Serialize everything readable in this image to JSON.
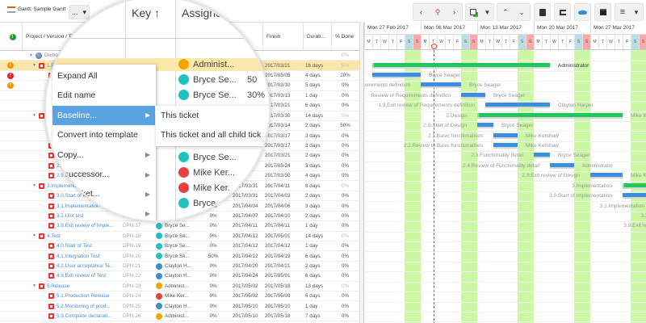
{
  "title": "Gantt: Sample Gantt",
  "title_menu": "...",
  "toolbar": {
    "prev": "‹",
    "today": "⚲",
    "next": "›",
    "caret": "▾",
    "up": "⌃",
    "down": "⌄",
    "menu": "≡"
  },
  "columns": {
    "project": "Project / Version / Ticket",
    "key": "Key",
    "sort": "↑",
    "assignee": "Assignee",
    "start_frag": "rt",
    "finish": "Finish",
    "duration": "Durati...",
    "done": "% Done"
  },
  "rows": [
    {
      "level": 0,
      "name": "Demo Project",
      "key": "",
      "assignee": "",
      "progress": "",
      "start": "",
      "finish": "",
      "duration": "",
      "done": "0%",
      "parent": true
    },
    {
      "level": 1,
      "name": "1.Requirements",
      "key": "DPN-1",
      "assignee": "Administ...",
      "av": "#f0a500",
      "progress": "",
      "start": "",
      "finish": "2017/03/21",
      "duration": "16 days",
      "done": "5%",
      "warn": "#f39200",
      "parent": true,
      "hl": true
    },
    {
      "level": 2,
      "name": "",
      "key": "",
      "assignee": "Bryce Se...",
      "av": "#1fc1c1",
      "progress": "50%",
      "start": "",
      "finish": "2017/03/05",
      "duration": "4 days",
      "done": "20%",
      "warn": "#e02020"
    },
    {
      "level": 2,
      "name": "",
      "key": "",
      "assignee": "Bryce Se...",
      "av": "#1fc1c1",
      "progress": "30%",
      "start": "",
      "finish": "2017/03/10",
      "duration": "5 days",
      "done": "0%",
      "warn": "#f39200"
    },
    {
      "level": 2,
      "name": "",
      "key": "",
      "assignee": "",
      "progress": "",
      "start": "",
      "finish": "2017/03/13",
      "duration": "1 day",
      "done": "0%"
    },
    {
      "level": 2,
      "name": "",
      "key": "",
      "assignee": "",
      "progress": "",
      "start": "",
      "finish": "2017/03/21",
      "duration": "6 days",
      "done": "0%"
    },
    {
      "level": 1,
      "name": "",
      "key": "",
      "assignee": "",
      "progress": "",
      "start": "",
      "finish": "2017/03/30",
      "duration": "14 days",
      "done": "5%",
      "parent": true
    },
    {
      "level": 2,
      "name": "",
      "key": "",
      "assignee": "",
      "progress": "",
      "start": "",
      "finish": "2017/03/14",
      "duration": "2 days",
      "done": "50%"
    },
    {
      "level": 2,
      "name": "",
      "key": "",
      "assignee": "",
      "progress": "",
      "start": "",
      "finish": "2017/03/17",
      "duration": "3 days",
      "done": "0%"
    },
    {
      "level": 2,
      "name": "",
      "key": "",
      "assignee": "",
      "progress": "",
      "start": "",
      "finish": "2017/03/17",
      "duration": "3 days",
      "done": "0%"
    },
    {
      "level": 2,
      "name": "",
      "key": "",
      "assignee": "Bryce Se...",
      "av": "#1fc1c1",
      "progress": "",
      "start": "",
      "finish": "2017/03/21",
      "duration": "2 days",
      "done": "0%"
    },
    {
      "level": 2,
      "name": "2.A",
      "key": "",
      "assignee": "Mike Ker...",
      "av": "#e84040",
      "progress": "",
      "start": "",
      "finish": "2017/03/24",
      "duration": "3 days",
      "done": "0%"
    },
    {
      "level": 2,
      "name": "2.9.E",
      "key": "",
      "assignee": "Mike Ker...",
      "av": "#e84040",
      "progress": "",
      "start": "",
      "finish": "2017/03/30",
      "duration": "4 days",
      "done": "0%"
    },
    {
      "level": 1,
      "name": "3.Implementation",
      "key": "",
      "assignee": "Mike Ker...",
      "av": "#e84040",
      "progress": "",
      "start": "2017/03/31",
      "finish": "2017/04/11",
      "duration": "8 days",
      "done": "0%",
      "parent": true
    },
    {
      "level": 2,
      "name": "3.0.Start of Im",
      "key": "",
      "assignee": "Bryce",
      "av": "#1fc1c1",
      "progress": "",
      "start": "2017/03/31",
      "finish": "2017/04/03",
      "duration": "2 days",
      "done": "0%"
    },
    {
      "level": 2,
      "name": "3.1.Implementation",
      "key": "",
      "assignee": "",
      "progress": "0%",
      "start": "2017/04/04",
      "finish": "2017/04/06",
      "duration": "3 days",
      "done": "0%"
    },
    {
      "level": 2,
      "name": "3.2.Unit test",
      "key": "DPN-16",
      "assignee": "Administ...",
      "av": "#f0a500",
      "progress": "0%",
      "start": "2017/04/07",
      "finish": "2017/04/10",
      "duration": "2 days",
      "done": "0%"
    },
    {
      "level": 2,
      "name": "3.9.Exit review of Imple...",
      "key": "DPN-17",
      "assignee": "Bryce Se...",
      "av": "#1fc1c1",
      "progress": "0%",
      "start": "2017/04/11",
      "finish": "2017/04/11",
      "duration": "1 day",
      "done": "0%"
    },
    {
      "level": 1,
      "name": "4.Test",
      "key": "DPN-18",
      "assignee": "Bryce Se...",
      "av": "#1fc1c1",
      "progress": "0%",
      "start": "2017/04/12",
      "finish": "2017/05/01",
      "duration": "14 days",
      "done": "0%",
      "parent": true
    },
    {
      "level": 2,
      "name": "4.0.Start of Test",
      "key": "DPN-19",
      "assignee": "Bryce Se...",
      "av": "#1fc1c1",
      "progress": "0%",
      "start": "2017/04/12",
      "finish": "2017/04/12",
      "duration": "1 day",
      "done": "0%"
    },
    {
      "level": 2,
      "name": "4.1.Integration Test",
      "key": "DPN-20",
      "assignee": "Bryce Se...",
      "av": "#1fc1c1",
      "progress": "50%",
      "start": "2017/04/12",
      "finish": "2017/04/19",
      "duration": "6 days",
      "done": "0%"
    },
    {
      "level": 2,
      "name": "4.2.User acceptance Te...",
      "key": "DPN-21",
      "assignee": "Clayton H...",
      "av": "#3a8fd0",
      "progress": "0%",
      "start": "2017/04/20",
      "finish": "2017/04/21",
      "duration": "2 days",
      "done": "0%"
    },
    {
      "level": 2,
      "name": "4.9.Exit review of Test",
      "key": "DPN-22",
      "assignee": "Clayton H...",
      "av": "#3a8fd0",
      "progress": "0%",
      "start": "2017/04/24",
      "finish": "2017/05/01",
      "duration": "6 days",
      "done": "0%"
    },
    {
      "level": 1,
      "name": "5.Release",
      "key": "DPN-23",
      "assignee": "Administ...",
      "av": "#f0a500",
      "progress": "0%",
      "start": "2017/05/02",
      "finish": "2017/05/18",
      "duration": "13 days",
      "done": "0%",
      "parent": true
    },
    {
      "level": 2,
      "name": "5.1.Production Release",
      "key": "DPN-24",
      "assignee": "Mike Ker...",
      "av": "#e84040",
      "progress": "0%",
      "start": "2017/05/02",
      "finish": "2017/05/09",
      "duration": "6 days",
      "done": "0%"
    },
    {
      "level": 2,
      "name": "5.2.Monitoring of prod...",
      "key": "DPN-25",
      "assignee": "Clayton H...",
      "av": "#3a8fd0",
      "progress": "0%",
      "start": "2017/05/10",
      "finish": "2017/05/10",
      "duration": "1 day",
      "done": "0%"
    },
    {
      "level": 2,
      "name": "5.9.Complete declarati...",
      "key": "DPN-26",
      "assignee": "Administ...",
      "av": "#f0a500",
      "progress": "0%",
      "start": "2017/05/10",
      "finish": "2017/05/18",
      "duration": "7 days",
      "done": "0%"
    }
  ],
  "gantt": {
    "weeks": [
      "Mon 27 Feb 2017",
      "Mon 06 Mar 2017",
      "Mon 13 Mar 2017",
      "Mon 20 Mar 2017",
      "Mon 27 Mar 2017"
    ],
    "weekdays": [
      "M",
      "T",
      "W",
      "T",
      "F",
      "S",
      "S"
    ],
    "today": "2017-03-07",
    "colors": {
      "task": "#3b8fde",
      "summary": "#1ec85a",
      "weekend": "#ccf7a3",
      "sat": "#b9dfe4",
      "sun": "#f5a9a9",
      "today": "#e33"
    },
    "bars": [
      {
        "row": 1,
        "type": "summary",
        "start": "2017-02-28",
        "end": "2017-03-21",
        "left": "",
        "right": "Administrator"
      },
      {
        "row": 2,
        "type": "task",
        "start": "2017-02-28",
        "end": "2017-03-05",
        "left": "",
        "right": "Bryce Seager"
      },
      {
        "row": 3,
        "type": "task",
        "start": "2017-03-06",
        "end": "2017-03-10",
        "left": "Requirements definition",
        "right": "Bryce Seager"
      },
      {
        "row": 4,
        "type": "task",
        "start": "2017-03-11",
        "end": "2017-03-13",
        "left": "Review of Requirements definition",
        "right": "Bryce Seager"
      },
      {
        "row": 5,
        "type": "task",
        "start": "2017-03-14",
        "end": "2017-03-21",
        "left": "1.9.Exit review of Requirements definition",
        "right": "Clayton Harper"
      },
      {
        "row": 6,
        "type": "summary",
        "start": "2017-03-13",
        "end": "2017-03-30",
        "left": "2.Design",
        "right": "Mike Kershaw"
      },
      {
        "row": 7,
        "type": "task",
        "start": "2017-03-13",
        "end": "2017-03-14",
        "left": "2.0.Start of Design",
        "right": "Bryce Seager"
      },
      {
        "row": 8,
        "type": "task",
        "start": "2017-03-15",
        "end": "2017-03-17",
        "left": "2.1.Basic functionalities",
        "right": "Mike Kershaw"
      },
      {
        "row": 9,
        "type": "task",
        "start": "2017-03-15",
        "end": "2017-03-17",
        "left": "2.2.Review of Basic functionalities",
        "right": "Mike Kershaw"
      },
      {
        "row": 10,
        "type": "task",
        "start": "2017-03-20",
        "end": "2017-03-21",
        "left": "2.3.Functionality detail",
        "right": "Bryce Seager"
      },
      {
        "row": 11,
        "type": "task",
        "start": "2017-03-22",
        "end": "2017-03-24",
        "left": "2.4.Review of Functionality detail",
        "right": "Administrator"
      },
      {
        "row": 12,
        "type": "task",
        "start": "2017-03-27",
        "end": "2017-03-30",
        "left": "2.9.Exit review of Design",
        "right": "Mike Kershaw"
      },
      {
        "row": 13,
        "type": "summary",
        "start": "2017-03-31",
        "end": "2017-04-11",
        "left": "3.Implementation",
        "right": ""
      },
      {
        "row": 14,
        "type": "task",
        "start": "2017-03-31",
        "end": "2017-04-03",
        "left": "3.0.Start of Implementation",
        "right": ""
      },
      {
        "row": 15,
        "type": "task",
        "start": "2017-04-04",
        "end": "2017-04-06",
        "left": "3.1.Implementation",
        "right": ""
      },
      {
        "row": 16,
        "type": "task",
        "start": "2017-04-07",
        "end": "2017-04-10",
        "left": "3.2.Unit test",
        "right": ""
      },
      {
        "row": 17,
        "type": "task",
        "start": "2017-04-11",
        "end": "2017-04-11",
        "left": "3.9.Exit review of Implementation",
        "right": ""
      }
    ]
  },
  "lens": {
    "rows": [
      {
        "assignee": "Administ...",
        "av": "#f0a500",
        "extra": ""
      },
      {
        "assignee": "Bryce Se...",
        "av": "#1fc1c1",
        "extra": "50"
      },
      {
        "assignee": "Bryce Se...",
        "av": "#1fc1c1",
        "extra": "30%"
      }
    ],
    "lower_rows": [
      {
        "assignee": "Bryce Se...",
        "av": "#1fc1c1"
      },
      {
        "assignee": "Mike Ker...",
        "av": "#e84040"
      },
      {
        "assignee": "Mike Ker.",
        "av": "#e84040"
      },
      {
        "assignee": "Bryce",
        "av": "#1fc1c1"
      }
    ],
    "menu": [
      {
        "label": "Expand All",
        "sub": false
      },
      {
        "label": "Edit name",
        "sub": false
      },
      {
        "label": "Baseline...",
        "sub": true,
        "active": true
      },
      {
        "label": "Convert into template",
        "sub": false
      },
      {
        "label": "Copy...",
        "sub": true
      },
      {
        "label": "d successor...",
        "sub": true
      },
      {
        "label": "hild ticket...",
        "sub": true
      },
      {
        "label": "PV...",
        "sub": true
      }
    ],
    "submenu": [
      "This ticket",
      "This ticket and all child tick"
    ],
    "menu_accent": "#5aa3e3"
  }
}
